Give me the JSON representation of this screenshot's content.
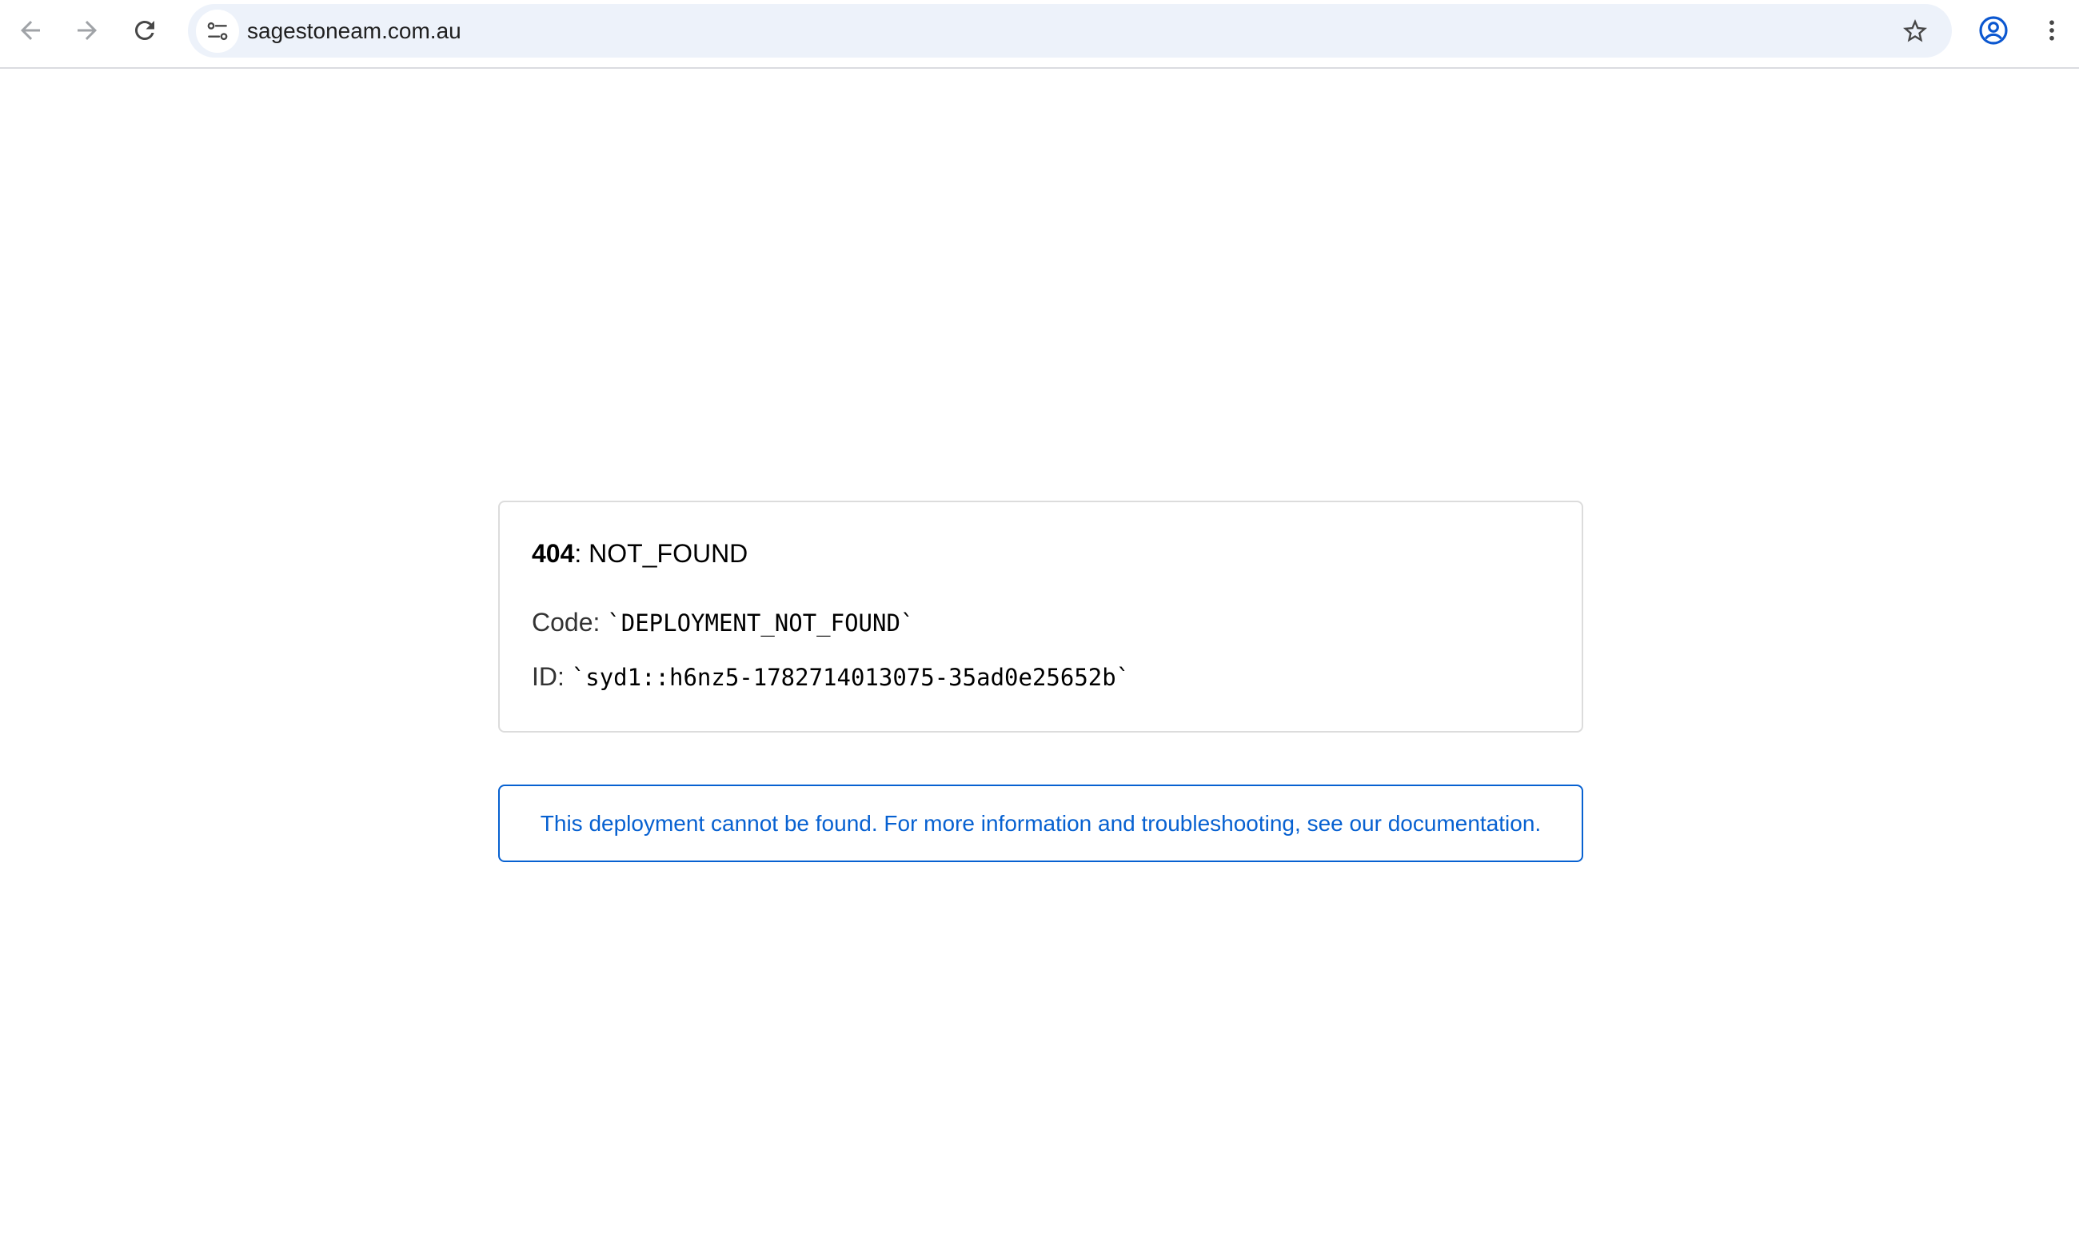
{
  "browser": {
    "url": "sagestoneam.com.au",
    "icons": {
      "back": "arrow-left-icon",
      "forward": "arrow-right-icon",
      "reload": "reload-icon",
      "site_info": "tune-icon",
      "bookmark": "star-icon",
      "profile": "account-circle-icon",
      "menu": "more-vert-icon"
    }
  },
  "error": {
    "status": "404",
    "status_separator": ": ",
    "status_text": "NOT_FOUND",
    "code_label": "Code: ",
    "code_value": "`DEPLOYMENT_NOT_FOUND`",
    "id_label": "ID: ",
    "id_value": "`syd1::h6nz5-1782714013075-35ad0e25652b`"
  },
  "info": {
    "text_before": "This deployment cannot be found. For more information and troubleshooting, see our ",
    "link_text": "documentation",
    "text_after": "."
  },
  "colors": {
    "link_blue": "#0761d1",
    "omnibox_bg": "#edf2fa",
    "profile_icon": "#0b57d0"
  }
}
